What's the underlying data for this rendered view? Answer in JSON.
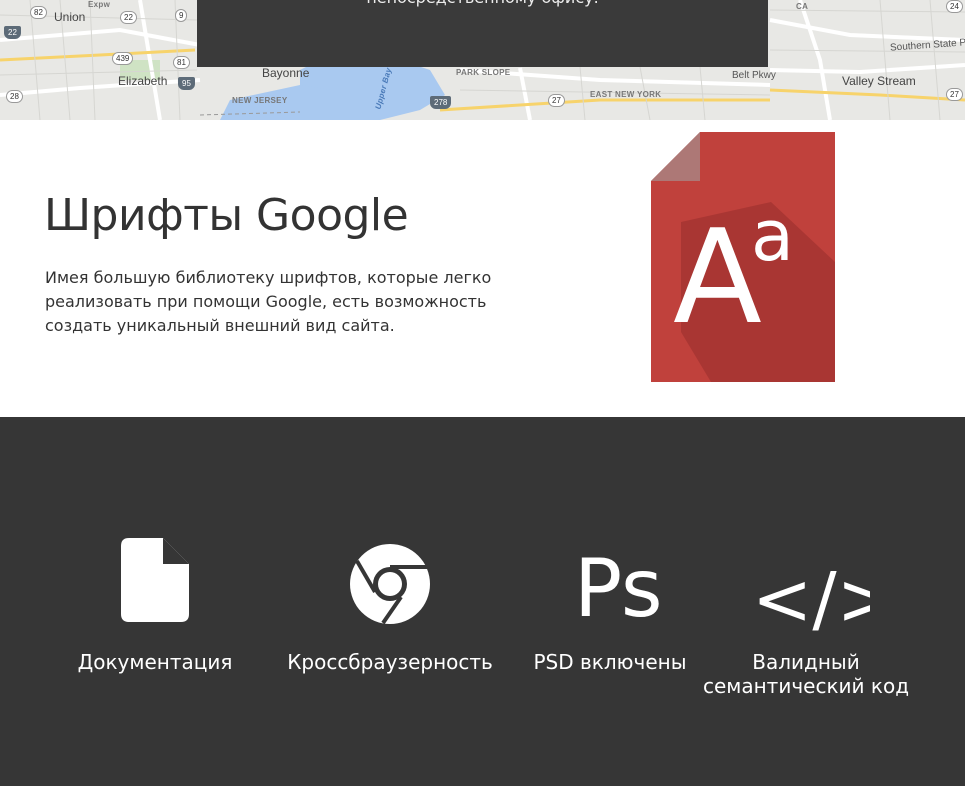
{
  "map": {
    "labels": {
      "union": "Union",
      "elizabeth": "Elizabeth",
      "bayonne": "Bayonne",
      "new_jersey": "NEW JERSEY",
      "upper_bay": "Upper Bay",
      "park_slope": "PARK SLOPE",
      "east_new_york": "EAST NEW YORK",
      "belt_pkwy": "Belt Pkwy",
      "valley_stream": "Valley Stream",
      "southern_state": "Southern State P",
      "ca": "CA",
      "expwy": "Expw"
    },
    "shields": {
      "s82": "82",
      "s22a": "22",
      "s22b": "22",
      "s9": "9",
      "s439": "439",
      "s81": "81",
      "s95": "95",
      "s28": "28",
      "s278": "278",
      "s27a": "27",
      "s27b": "27",
      "s24": "24"
    },
    "overlay_text": "непосредственному офису."
  },
  "fonts_section": {
    "title": "Шрифты Google",
    "description": "Имея большую библиотеку шрифтов, которые легко реализовать при помощи Google, есть возможность создать уникальный внешний вид сайта.",
    "icon_glyph_upper": "A",
    "icon_glyph_lower": "a",
    "icon_color": "#c0413c"
  },
  "features": {
    "items": [
      {
        "label": "Документация",
        "icon": "document-icon"
      },
      {
        "label": "Кроссбраузерность",
        "icon": "chrome-icon"
      },
      {
        "label": "PSD включены",
        "icon": "photoshop-icon",
        "glyph": "Ps"
      },
      {
        "label_line1": "Валидный",
        "label_line2": "семантический код",
        "icon": "code-icon",
        "glyph": "</>"
      }
    ],
    "background": "#363636"
  }
}
